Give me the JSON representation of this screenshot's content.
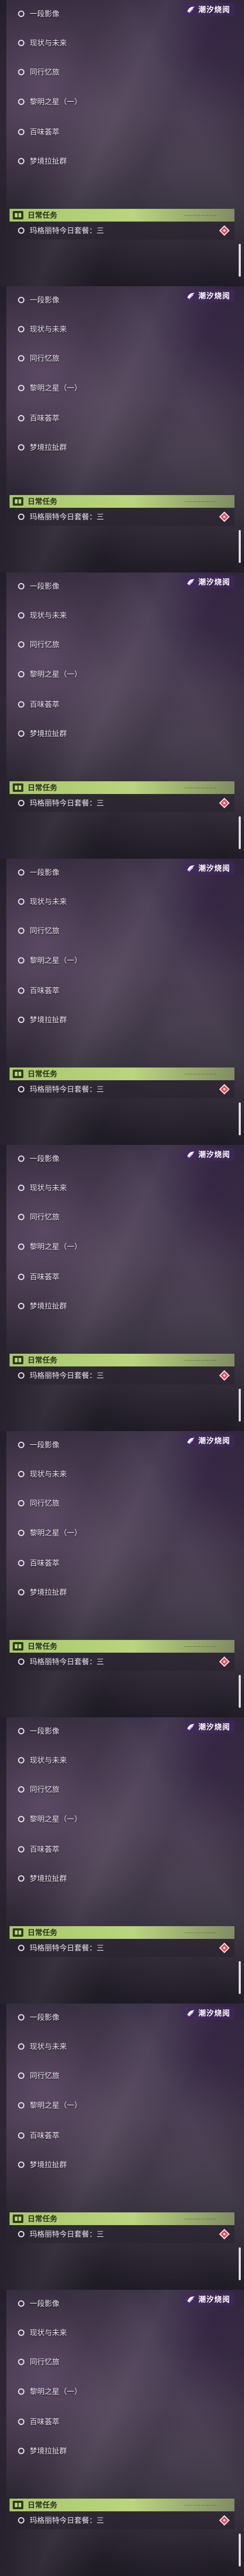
{
  "logo_text": "潮汐烧阅",
  "quests": [
    "一段影像",
    "现状与未来",
    "同行忆旅",
    "黎明之星（一）",
    "百味荟萃",
    "梦境拉扯群"
  ],
  "daily_header": "日常任务",
  "daily_item": "玛格丽特今日套餐：三",
  "panel_count": 9,
  "colors": {
    "daily_bar": "#b9d57e",
    "marker": "#e8475a",
    "logo_bg": "#5a3a80"
  },
  "icons": {
    "quest": "ring-icon",
    "daily": "book-icon",
    "marker": "map-marker-icon",
    "logo": "tide-logo-icon"
  }
}
